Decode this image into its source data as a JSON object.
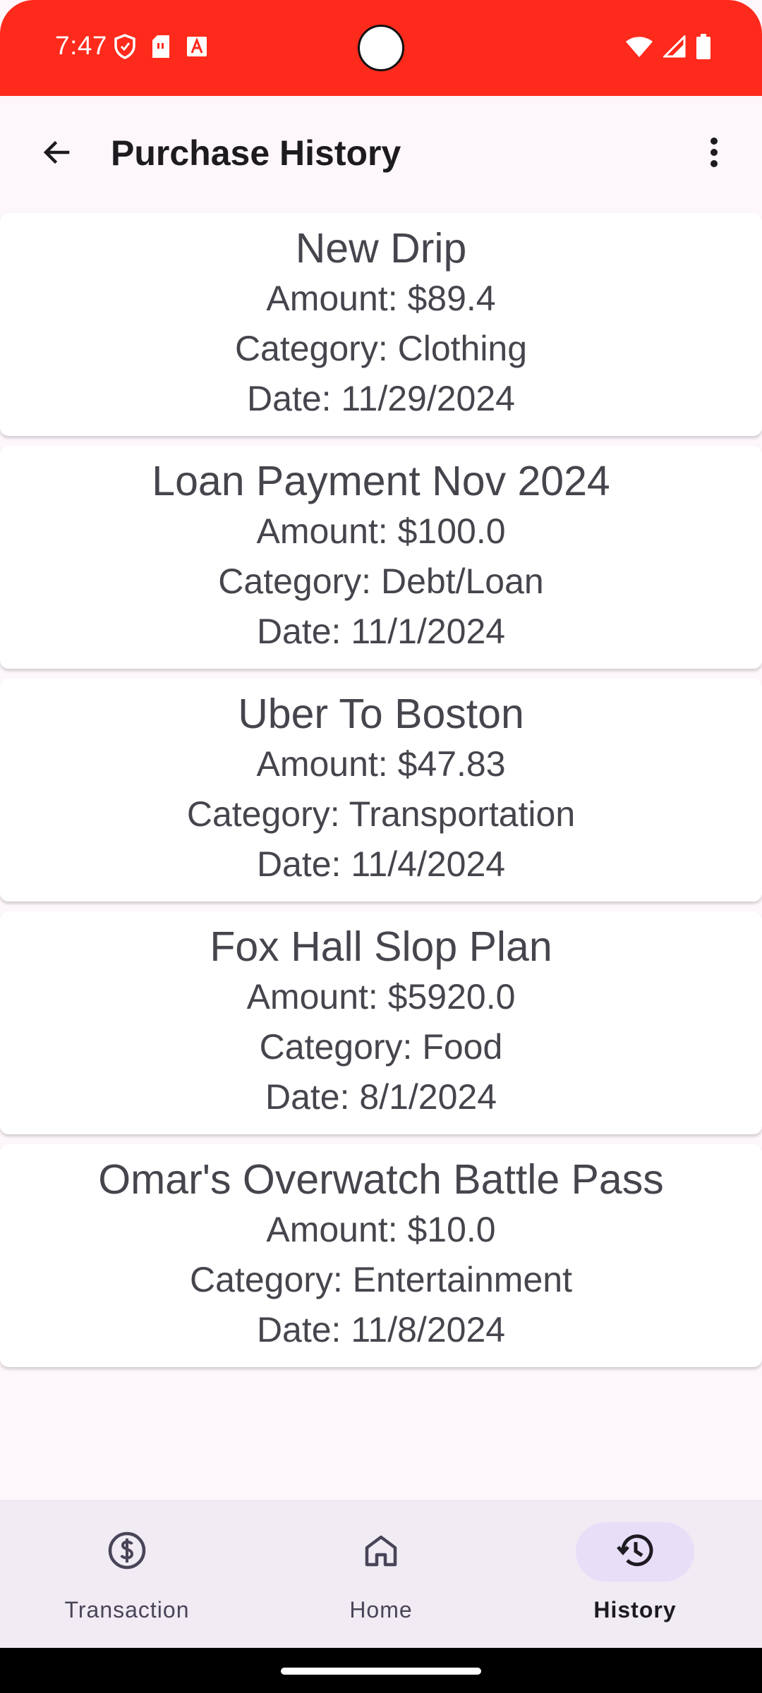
{
  "status_bar": {
    "time": "7:47",
    "color": "#fe2a1c",
    "left_icons": [
      "shield-icon",
      "sim-card-icon",
      "font-download-icon"
    ],
    "right_icons": [
      "wifi-icon",
      "signal-icon",
      "battery-icon"
    ]
  },
  "app_bar": {
    "title": "Purchase History",
    "back_icon": "arrow-back-icon",
    "menu_icon": "more-vert-icon"
  },
  "purchases": [
    {
      "title": "New Drip",
      "amount": "Amount: $89.4",
      "category": "Category: Clothing",
      "date": "Date: 11/29/2024"
    },
    {
      "title": "Loan Payment Nov 2024",
      "amount": "Amount: $100.0",
      "category": "Category: Debt/Loan",
      "date": "Date: 11/1/2024"
    },
    {
      "title": "Uber To Boston",
      "amount": "Amount: $47.83",
      "category": "Category: Transportation",
      "date": "Date: 11/4/2024"
    },
    {
      "title": "Fox Hall Slop Plan",
      "amount": "Amount: $5920.0",
      "category": "Category: Food",
      "date": "Date: 8/1/2024"
    },
    {
      "title": "Omar's Overwatch Battle Pass",
      "amount": "Amount: $10.0",
      "category": "Category: Entertainment",
      "date": "Date: 11/8/2024"
    }
  ],
  "bottom_nav": {
    "items": [
      {
        "label": "Transaction",
        "icon": "dollar-circle-icon",
        "active": false
      },
      {
        "label": "Home",
        "icon": "home-icon",
        "active": false
      },
      {
        "label": "History",
        "icon": "history-icon",
        "active": true
      }
    ],
    "active_indicator_color": "#e8def8",
    "background_color": "#f1ebf4"
  }
}
